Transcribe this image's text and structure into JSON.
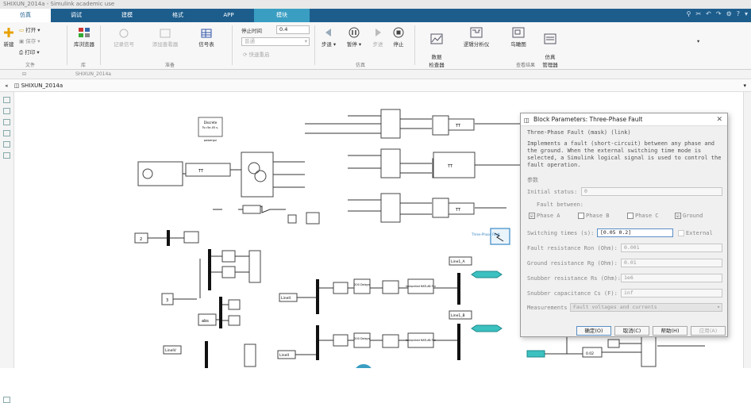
{
  "window": {
    "title": "SHIXUN_2014a - Simulink academic use"
  },
  "tabs": [
    {
      "label": "仿真"
    },
    {
      "label": "调试"
    },
    {
      "label": "建模"
    },
    {
      "label": "格式"
    },
    {
      "label": "APP"
    },
    {
      "label": "模块"
    }
  ],
  "ribbon": {
    "file": {
      "new_label": "新建",
      "open_label": "打开",
      "save_label": "保存",
      "print_label": "打印",
      "group_label": "文件"
    },
    "library": {
      "browser_label": "库浏览器",
      "group_label": "库"
    },
    "prepare": {
      "record_label": "记录信号",
      "add_viewer_label": "添加查看器",
      "signal_table_label": "信号表",
      "group_label": "准备"
    },
    "stop_time": {
      "label": "停止时间",
      "value": "0.4"
    },
    "mode": {
      "value": "普通"
    },
    "fast_restart_label": "快速重启",
    "simulate": {
      "step_back_label": "步退",
      "pause_label": "暂停",
      "step_fwd_label": "步进",
      "stop_label": "停止",
      "group_label": "仿真"
    },
    "review": {
      "data_inspector_label": "数据\n检查器",
      "logic_analyzer_label": "逻辑分析仪",
      "bird_view_label": "鸟瞰图",
      "sim_manager_label": "仿真\n管理器",
      "group_label": "查看结果"
    }
  },
  "breadcrumb": {
    "tab_label": "SHIXUN_2014a",
    "path": "SHIXUN_2014a"
  },
  "dialog": {
    "title": "Block Parameters: Three-Phase Fault",
    "subtitle": "Three-Phase Fault (mask) (link)",
    "description": "Implements a fault (short-circuit) between any phase and the ground. When the external switching time mode is selected, a Simulink logical signal is used to control the fault operation.",
    "params_label": "参数",
    "initial_status_label": "Initial status:",
    "initial_status_value": "0",
    "fault_between_label": "Fault between:",
    "phase_a": {
      "label": "Phase A",
      "checked": "☑"
    },
    "phase_b": {
      "label": "Phase B",
      "checked": ""
    },
    "phase_c": {
      "label": "Phase C",
      "checked": ""
    },
    "ground": {
      "label": "Ground",
      "checked": "☑"
    },
    "switching_label": "Switching times (s):",
    "switching_value": "[0.05  0.2]",
    "external_label": "External",
    "fault_res_label": "Fault resistance Ron (Ohm):",
    "fault_res_value": "0.001",
    "ground_res_label": "Ground resistance Rg (Ohm):",
    "ground_res_value": "0.01",
    "snubber_res_label": "Snubber resistance Rs (Ohm):",
    "snubber_res_value": "1e6",
    "snubber_cap_label": "Snubber capacitance Cs (F):",
    "snubber_cap_value": "inf",
    "measurements_label": "Measurements",
    "measurements_value": "Fault voltages and currents",
    "ok_label": "确定(O)",
    "cancel_label": "取消(C)",
    "help_label": "帮助(H)",
    "apply_label": "应用(A)"
  },
  "diagram": {
    "discrete_label": "Discrete",
    "discrete_sub": "Ts=5e-05 s.",
    "powergui_label": "powergui",
    "fault_block_label": "Three-Phase Fault",
    "line1a_label": "Line1_A",
    "line1b_label": "Line1_B",
    "lineiv_label": "LineIV",
    "lineii_label": "LineII",
    "const2_label": "2",
    "const3_label": "3",
    "delay_label": "200 Delays",
    "interp_label": "Interpreted MATLAB Fcn",
    "tt_label": "TT",
    "gain_label": "0.02",
    "abs_label": "abs",
    "color_accent": "#3cc0c0"
  },
  "colors": {
    "tab_bar": "#1d5d8c",
    "sim_tab": "#3a9ec2"
  }
}
